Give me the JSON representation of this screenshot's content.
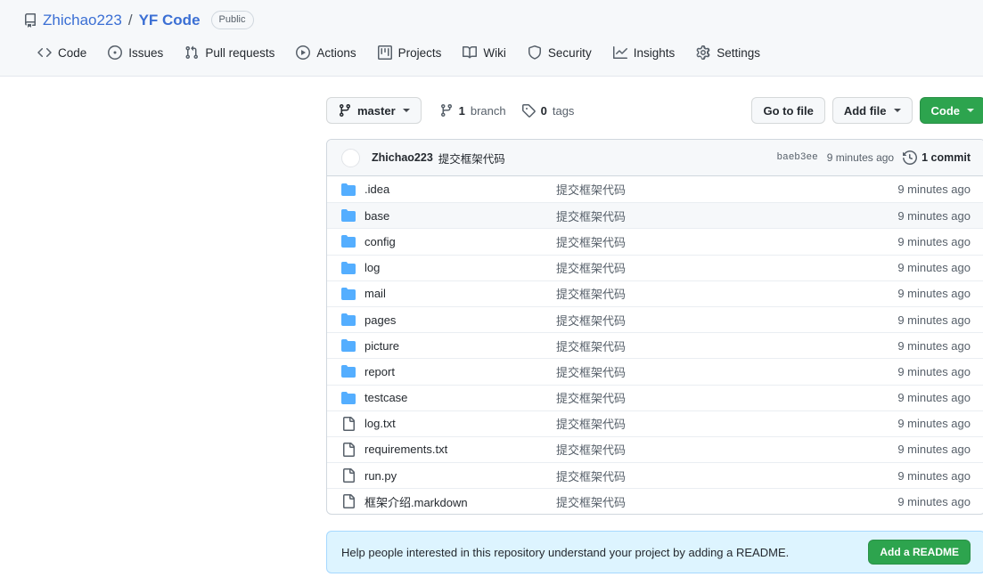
{
  "header": {
    "repo_icon": "repo-icon",
    "owner": "Zhichao223",
    "separator": "/",
    "repo_name": "YF Code",
    "visibility": "Public"
  },
  "nav": {
    "items": [
      {
        "label": "Code",
        "icon": "code-icon"
      },
      {
        "label": "Issues",
        "icon": "issue-opened-icon"
      },
      {
        "label": "Pull requests",
        "icon": "git-pull-request-icon"
      },
      {
        "label": "Actions",
        "icon": "play-icon"
      },
      {
        "label": "Projects",
        "icon": "project-icon"
      },
      {
        "label": "Wiki",
        "icon": "book-icon"
      },
      {
        "label": "Security",
        "icon": "shield-icon"
      },
      {
        "label": "Insights",
        "icon": "graph-icon"
      },
      {
        "label": "Settings",
        "icon": "gear-icon"
      }
    ]
  },
  "toolbar": {
    "branch_label": "master",
    "branch_icon": "git-branch-icon",
    "branch_count_value": "1",
    "branch_count_label": "branch",
    "tag_count_value": "0",
    "tag_count_label": "tags",
    "tag_icon": "tag-icon",
    "go_to_file_label": "Go to file",
    "add_file_label": "Add file",
    "code_label": "Code"
  },
  "commit": {
    "avatar": "avatar",
    "author": "Zhichao223",
    "message": "提交框架代码",
    "sha": "baeb3ee",
    "time": "9 minutes ago",
    "count_label": "1 commit",
    "count_icon": "history-icon"
  },
  "files": {
    "columns": [
      "name",
      "message",
      "time"
    ],
    "rows": [
      {
        "name": ".idea",
        "type": "folder",
        "icon": "folder-icon",
        "message": "提交框架代码",
        "time": "9 minutes ago"
      },
      {
        "name": "base",
        "type": "folder",
        "icon": "folder-icon",
        "message": "提交框架代码",
        "time": "9 minutes ago"
      },
      {
        "name": "config",
        "type": "folder",
        "icon": "folder-icon",
        "message": "提交框架代码",
        "time": "9 minutes ago"
      },
      {
        "name": "log",
        "type": "folder",
        "icon": "folder-icon",
        "message": "提交框架代码",
        "time": "9 minutes ago"
      },
      {
        "name": "mail",
        "type": "folder",
        "icon": "folder-icon",
        "message": "提交框架代码",
        "time": "9 minutes ago"
      },
      {
        "name": "pages",
        "type": "folder",
        "icon": "folder-icon",
        "message": "提交框架代码",
        "time": "9 minutes ago"
      },
      {
        "name": "picture",
        "type": "folder",
        "icon": "folder-icon",
        "message": "提交框架代码",
        "time": "9 minutes ago"
      },
      {
        "name": "report",
        "type": "folder",
        "icon": "folder-icon",
        "message": "提交框架代码",
        "time": "9 minutes ago"
      },
      {
        "name": "testcase",
        "type": "folder",
        "icon": "folder-icon",
        "message": "提交框架代码",
        "time": "9 minutes ago"
      },
      {
        "name": "log.txt",
        "type": "file",
        "icon": "file-icon",
        "message": "提交框架代码",
        "time": "9 minutes ago"
      },
      {
        "name": "requirements.txt",
        "type": "file",
        "icon": "file-icon",
        "message": "提交框架代码",
        "time": "9 minutes ago"
      },
      {
        "name": "run.py",
        "type": "file",
        "icon": "file-icon",
        "message": "提交框架代码",
        "time": "9 minutes ago"
      },
      {
        "name": "框架介绍.markdown",
        "type": "file",
        "icon": "file-icon",
        "message": "提交框架代码",
        "time": "9 minutes ago"
      }
    ]
  },
  "readme_prompt": {
    "text": "Help people interested in this repository understand your project by adding a README.",
    "button_label": "Add a README"
  },
  "colors": {
    "link": "#3b6fd4",
    "green": "#2da44e",
    "folder": "#54aeff",
    "muted": "#57606a",
    "header_bg": "#f6f8fa",
    "banner_bg": "#ddf4ff"
  }
}
